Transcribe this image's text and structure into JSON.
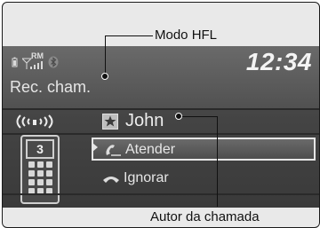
{
  "annotations": {
    "top_label": "Modo HFL",
    "bottom_label": "Autor da chamada"
  },
  "status_bar": {
    "roaming_badge": "RM",
    "time": "12:34",
    "icons": [
      "battery-icon",
      "signal-strength-icon",
      "bluetooth-icon"
    ]
  },
  "screen": {
    "mode_text": "Rec. cham.",
    "caller_name": "John",
    "keypad_digit": "3",
    "options": [
      {
        "label": "Atender",
        "icon": "answer-phone-icon",
        "selected": true
      },
      {
        "label": "Ignorar",
        "icon": "hang-up-phone-icon",
        "selected": false
      }
    ]
  },
  "colors": {
    "screen_dark": "#444444",
    "screen_light": "#5d5d5d",
    "text": "#e6e6e6",
    "frame_bg": "#e9e9e9"
  }
}
